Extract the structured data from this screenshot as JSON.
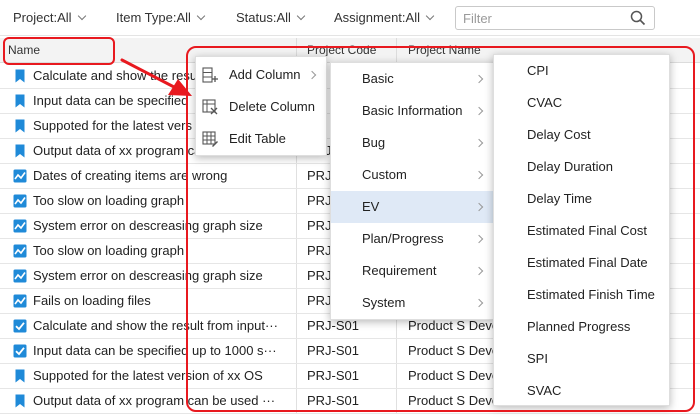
{
  "filters": [
    {
      "label": "Project:All"
    },
    {
      "label": "Item Type:All"
    },
    {
      "label": "Status:All"
    },
    {
      "label": "Assignment:All"
    }
  ],
  "search": {
    "placeholder": "Filter",
    "value": ""
  },
  "columns": {
    "name": "Name",
    "code": "Project Code",
    "pname": "Project Name"
  },
  "rows": [
    {
      "icon": "bookmark-icon",
      "name": "Calculate and show the resu",
      "code": "",
      "pname": ""
    },
    {
      "icon": "bookmark-icon",
      "name": "Input data can be specified",
      "code": "",
      "pname": ""
    },
    {
      "icon": "bookmark-icon",
      "name": "Suppoted for the latest vers",
      "code": "",
      "pname": ""
    },
    {
      "icon": "bookmark-icon",
      "name": "Output data of xx program can be used",
      "code": "PRJ-",
      "pname": ""
    },
    {
      "icon": "bug-chart-icon",
      "name": "Dates of creating items are wrong",
      "code": "PRJ-",
      "pname": ""
    },
    {
      "icon": "bug-chart-icon",
      "name": "Too slow on loading graph",
      "code": "PRJ-",
      "pname": ""
    },
    {
      "icon": "bug-chart-icon",
      "name": "System error on descreasing graph size",
      "code": "PRJ-",
      "pname": ""
    },
    {
      "icon": "bug-chart-icon",
      "name": "Too slow on loading graph",
      "code": "PRJ-",
      "pname": ""
    },
    {
      "icon": "bug-chart-icon",
      "name": "System error on descreasing graph size",
      "code": "PRJ-",
      "pname": ""
    },
    {
      "icon": "bug-chart-icon",
      "name": "Fails on loading files",
      "code": "PRJ-",
      "pname": ""
    },
    {
      "icon": "check-icon",
      "name": "Calculate and show the result from input···",
      "code": "PRJ-S01",
      "pname": "Product S Deve"
    },
    {
      "icon": "check-icon",
      "name": "Input data can be specified up to 1000 s···",
      "code": "PRJ-S01",
      "pname": "Product S Deve"
    },
    {
      "icon": "bookmark-icon",
      "name": "Suppoted for the latest version of xx OS",
      "code": "PRJ-S01",
      "pname": "Product S Deve"
    },
    {
      "icon": "bookmark-icon",
      "name": "Output data of xx program can be used ···",
      "code": "PRJ-S01",
      "pname": "Product S Deve"
    }
  ],
  "context_menu": [
    {
      "label": "Add Column",
      "icon": "add-column-icon",
      "has_submenu": true
    },
    {
      "label": "Delete Column",
      "icon": "delete-column-icon",
      "has_submenu": false
    },
    {
      "label": "Edit Table",
      "icon": "edit-table-icon",
      "has_submenu": false
    }
  ],
  "category_menu": [
    {
      "label": "Basic"
    },
    {
      "label": "Basic Information"
    },
    {
      "label": "Bug"
    },
    {
      "label": "Custom"
    },
    {
      "label": "EV",
      "selected": true
    },
    {
      "label": "Plan/Progress"
    },
    {
      "label": "Requirement"
    },
    {
      "label": "System"
    }
  ],
  "ev_menu": [
    {
      "label": "CPI"
    },
    {
      "label": "CVAC"
    },
    {
      "label": "Delay Cost"
    },
    {
      "label": "Delay Duration"
    },
    {
      "label": "Delay Time"
    },
    {
      "label": "Estimated Final Cost"
    },
    {
      "label": "Estimated Final Date"
    },
    {
      "label": "Estimated Finish Time"
    },
    {
      "label": "Planned Progress"
    },
    {
      "label": "SPI"
    },
    {
      "label": "SVAC"
    }
  ],
  "colors": {
    "annotation": "#e8191f",
    "icon_blue": "#1f8ad8",
    "selected_bg": "#dfe9f6"
  }
}
